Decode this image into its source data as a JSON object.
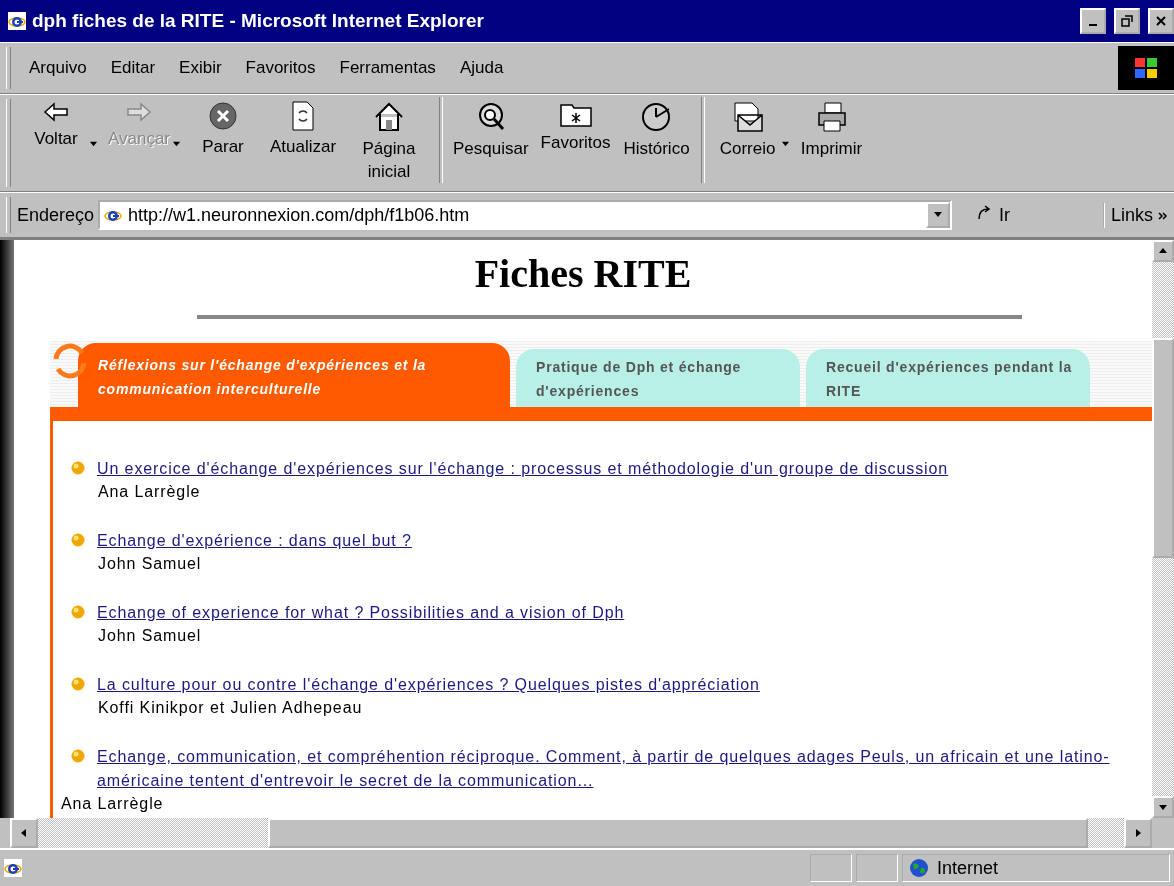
{
  "window": {
    "title": "dph fiches de la RITE - Microsoft Internet Explorer"
  },
  "menu": [
    "Arquivo",
    "Editar",
    "Exibir",
    "Favoritos",
    "Ferramentas",
    "Ajuda"
  ],
  "toolbar": [
    {
      "label": "Voltar",
      "disabled": false,
      "has_menu": true
    },
    {
      "label": "Avançar",
      "disabled": true,
      "has_menu": true
    },
    {
      "label": "Parar",
      "disabled": false,
      "has_menu": false
    },
    {
      "label": "Atualizar",
      "disabled": false,
      "has_menu": false
    },
    {
      "label": "Página inicial",
      "disabled": false,
      "has_menu": false
    },
    {
      "label": "Pesquisar",
      "disabled": false,
      "has_menu": false
    },
    {
      "label": "Favoritos",
      "disabled": false,
      "has_menu": false
    },
    {
      "label": "Histórico",
      "disabled": false,
      "has_menu": false
    },
    {
      "label": "Correio",
      "disabled": false,
      "has_menu": true
    },
    {
      "label": "Imprimir",
      "disabled": false,
      "has_menu": false
    }
  ],
  "address": {
    "label": "Endereço",
    "value": "http://w1.neuronnexion.com/dph/f1b06.htm",
    "go": "Ir",
    "links": "Links"
  },
  "page": {
    "heading": "Fiches RITE",
    "tabs": [
      {
        "label": "Réflexions sur l'échange d'expériences et la communication interculturelle",
        "selected": true
      },
      {
        "label": "Pratique de Dph et échange d'expériences",
        "selected": false
      },
      {
        "label": "Recueil d'expériences pendant la RITE",
        "selected": false
      }
    ],
    "entries": [
      {
        "title": "Un exercice d'échange d'expériences sur l'échange : processus et méthodologie d'un groupe de discussion",
        "author": "Ana Larrègle",
        "author_indented": true
      },
      {
        "title": "Echange d'expérience : dans quel but ?",
        "author": "John Samuel",
        "author_indented": true
      },
      {
        "title": "Echange of experience for what ? Possibilities and a vision of Dph",
        "author": "John Samuel",
        "author_indented": true
      },
      {
        "title": "La culture pour ou contre l'échange d'expériences ? Quelques pistes d'appréciation",
        "author": "Koffi Kinikpor et Julien Adhepeau",
        "author_indented": true
      },
      {
        "title": "Echange, communication, et compréhention réciproque. Comment, à partir de quelques adages Peuls, un africain et une latino-américaine tentent d'entrevoir le secret de la communication...",
        "author": "Ana Larrègle",
        "author_indented": false
      }
    ]
  },
  "status_bar": {
    "zone": "Internet"
  }
}
